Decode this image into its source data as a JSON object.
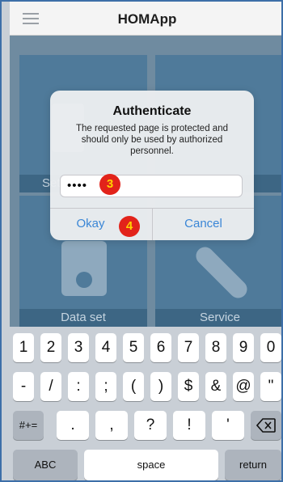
{
  "header": {
    "title": "HOMApp",
    "menu_icon": "hamburger-menu-icon"
  },
  "tiles": [
    {
      "label": "Setup"
    },
    {
      "label": ""
    },
    {
      "label": "Data set"
    },
    {
      "label": "Service"
    }
  ],
  "dialog": {
    "title": "Authenticate",
    "message": "The requested page is protected and should only be used by authorized personnel.",
    "password_value": "••••",
    "okay_label": "Okay",
    "cancel_label": "Cancel"
  },
  "annotations": {
    "step3": "3",
    "step4": "4"
  },
  "keyboard": {
    "row1": [
      "1",
      "2",
      "3",
      "4",
      "5",
      "6",
      "7",
      "8",
      "9",
      "0"
    ],
    "row2": [
      "-",
      "/",
      ":",
      ";",
      "(",
      ")",
      "$",
      "&",
      "@",
      "\""
    ],
    "row3_left": "#+=",
    "row3": [
      ".",
      ",",
      "?",
      "!",
      "'"
    ],
    "row3_right_icon": "backspace-icon",
    "bottom": {
      "abc": "ABC",
      "space": "space",
      "return": "return"
    }
  },
  "colors": {
    "frame": "#3d6fa8",
    "badge_fill": "#e2231a",
    "badge_text": "#ffd400",
    "link": "#3a86d6"
  }
}
